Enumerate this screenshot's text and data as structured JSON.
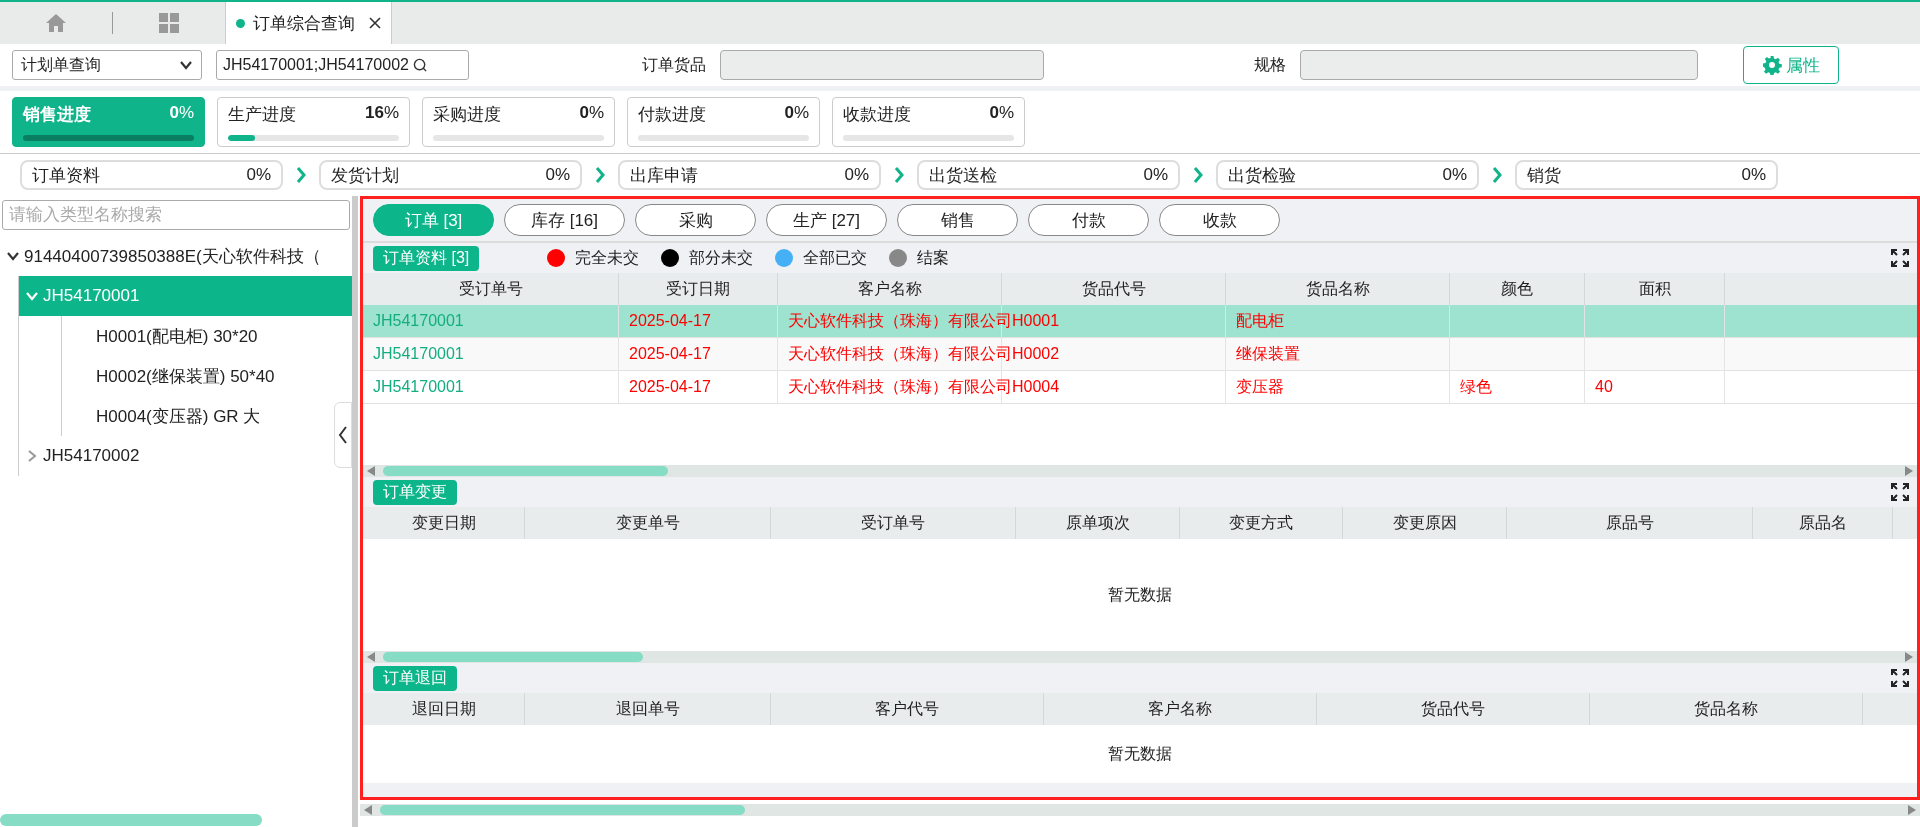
{
  "open_tabs": [
    {
      "label": "订单综合查询",
      "selected": true
    }
  ],
  "query": {
    "mode": "计划单查询",
    "search_value": "JH54170001;JH54170002",
    "goods_label": "订单货品",
    "spec_label": "规格",
    "properties_button": "属性"
  },
  "progress": [
    {
      "label": "销售进度",
      "reading": "**0**%",
      "level": 0,
      "selected": true
    },
    {
      "label": "生产进度",
      "reading": "**16**%",
      "level": 0.16,
      "selected": false
    },
    {
      "label": "采购进度",
      "reading": "**0**%",
      "level": 0,
      "selected": false
    },
    {
      "label": "付款进度",
      "reading": "**0**%",
      "level": 0,
      "selected": false
    },
    {
      "label": "收款进度",
      "reading": "**0**%",
      "level": 0,
      "selected": false
    }
  ],
  "stages": [
    {
      "label": "订单资料",
      "reading": "0%"
    },
    {
      "label": "发货计划",
      "reading": "0%"
    },
    {
      "label": "出库申请",
      "reading": "0%"
    },
    {
      "label": "出货送检",
      "reading": "0%"
    },
    {
      "label": "出货检验",
      "reading": "0%"
    },
    {
      "label": "销货",
      "reading": "0%"
    }
  ],
  "tree": {
    "placeholder": "请输入类型名称搜索",
    "nodes": [
      {
        "label": "91440400739850388E(天心软件科技（",
        "expanded": true,
        "selected": false,
        "children": [
          {
            "label": "JH54170001",
            "expanded": true,
            "selected": true,
            "children": [
              {
                "label": "H0001(配电柜) 30*20",
                "selected": false
              },
              {
                "label": "H0002(继保装置) 50*40",
                "selected": false
              },
              {
                "label": "H0004(变压器) GR 大",
                "selected": false
              }
            ]
          },
          {
            "label": "JH54170002",
            "expanded": false,
            "selected": false
          }
        ]
      }
    ]
  },
  "detail_tabs": [
    {
      "label": "订单 [3]",
      "selected": true
    },
    {
      "label": "库存 [16]",
      "selected": false
    },
    {
      "label": "采购",
      "selected": false
    },
    {
      "label": "生产 [27]",
      "selected": false
    },
    {
      "label": "销售",
      "selected": false
    },
    {
      "label": "付款",
      "selected": false
    },
    {
      "label": "收款",
      "selected": false
    }
  ],
  "sections": [
    {
      "title": "订单资料 [3]",
      "legend": [
        {
          "label": "完全未交",
          "color": "#ff0000"
        },
        {
          "label": "部分未交",
          "color": "#000000"
        },
        {
          "label": "全部已交",
          "color": "#45b0f5"
        },
        {
          "label": "结案",
          "color": "#888888"
        }
      ],
      "columns": [
        "受订单号",
        "受订日期",
        "客户名称",
        "货品代号",
        "货品名称",
        "颜色",
        "面积"
      ],
      "rows": [
        {
          "selected": true,
          "color": "#ff0000",
          "cells": [
            "JH54170001",
            "2025-04-17",
            "天心软件科技（珠海）有限公司",
            "H0001",
            "配电柜",
            null,
            null
          ]
        },
        {
          "selected": false,
          "color": "#ff0000",
          "cells": [
            "JH54170001",
            "2025-04-17",
            "天心软件科技（珠海）有限公司",
            "H0002",
            "继保装置",
            null,
            null
          ]
        },
        {
          "selected": false,
          "color": "#ff0000",
          "cells": [
            "JH54170001",
            "2025-04-17",
            "天心软件科技（珠海）有限公司",
            "H0004",
            "变压器",
            "绿色",
            "40"
          ]
        }
      ]
    },
    {
      "title": "订单变更",
      "columns": [
        "变更日期",
        "变更单号",
        "受订单号",
        "原单项次",
        "变更方式",
        "变更原因",
        "原品号",
        "原品名"
      ],
      "empty_text": "暂无数据"
    },
    {
      "title": "订单退回",
      "columns": [
        "退回日期",
        "退回单号",
        "客户代号",
        "客户名称",
        "货品代号",
        "货品名称"
      ],
      "empty_text": "暂无数据"
    }
  ]
}
